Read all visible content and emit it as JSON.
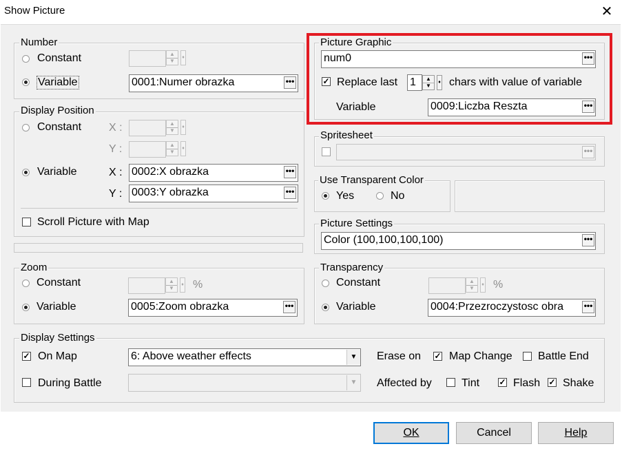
{
  "window": {
    "title": "Show Picture",
    "close_glyph": "✕"
  },
  "number": {
    "label": "Number",
    "constant_label": "Constant",
    "variable_label": "Variable",
    "selected": "variable",
    "variable_value": "0001:Numer obrazka"
  },
  "display_position": {
    "label": "Display Position",
    "constant_label": "Constant",
    "variable_label": "Variable",
    "selected": "variable",
    "x_label": "X :",
    "y_label": "Y :",
    "x_value": "0002:X obrazka",
    "y_value": "0003:Y obrazka",
    "scroll_label": "Scroll Picture with Map",
    "scroll_checked": false
  },
  "zoom": {
    "label": "Zoom",
    "constant_label": "Constant",
    "variable_label": "Variable",
    "selected": "variable",
    "percent": "%",
    "variable_value": "0005:Zoom obrazka"
  },
  "picture_graphic": {
    "label": "Picture Graphic",
    "value": "num0",
    "replace_checked": true,
    "replace_prefix": "Replace last",
    "replace_count": "1",
    "replace_suffix": "chars with value of variable",
    "variable_label": "Variable",
    "variable_value": "0009:Liczba Reszta"
  },
  "spritesheet": {
    "label": "Spritesheet",
    "checked": false
  },
  "transparent_color": {
    "label": "Use Transparent Color",
    "yes_label": "Yes",
    "no_label": "No",
    "selected": "yes"
  },
  "picture_settings": {
    "label": "Picture Settings",
    "value": "Color (100,100,100,100)"
  },
  "transparency": {
    "label": "Transparency",
    "constant_label": "Constant",
    "variable_label": "Variable",
    "selected": "variable",
    "percent": "%",
    "variable_value": "0004:Przezroczystosc obra"
  },
  "display_settings": {
    "label": "Display Settings",
    "on_map_label": "On Map",
    "on_map_checked": true,
    "on_map_value": "6: Above weather effects",
    "during_battle_label": "During Battle",
    "during_battle_checked": false,
    "erase_on_label": "Erase on",
    "map_change_label": "Map Change",
    "map_change_checked": true,
    "battle_end_label": "Battle End",
    "battle_end_checked": false,
    "affected_by_label": "Affected by",
    "tint_label": "Tint",
    "tint_checked": false,
    "flash_label": "Flash",
    "flash_checked": true,
    "shake_label": "Shake",
    "shake_checked": true
  },
  "buttons": {
    "ok": "OK",
    "cancel": "Cancel",
    "help": "Help"
  },
  "icons": {
    "ellipsis": "•••",
    "check": "✓",
    "dropdown": "▼",
    "spin_up": "▲",
    "spin_down": "▼",
    "grip": "♦"
  }
}
